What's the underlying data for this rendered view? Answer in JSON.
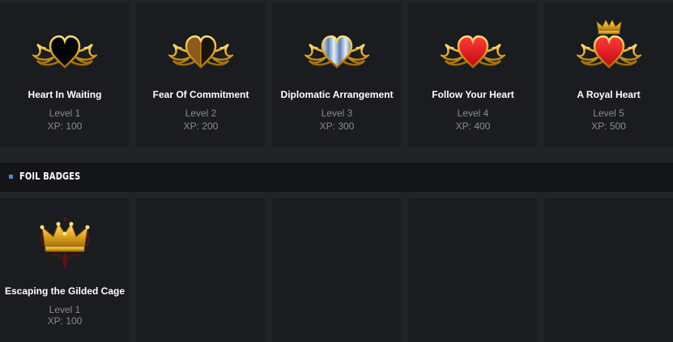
{
  "badges": [
    {
      "name": "Heart In Waiting",
      "level": "Level 1",
      "xp": "XP: 100",
      "icon": "black-heart-icon"
    },
    {
      "name": "Fear Of Commitment",
      "level": "Level 2",
      "xp": "XP: 200",
      "icon": "split-heart-icon"
    },
    {
      "name": "Diplomatic Arrangement",
      "level": "Level 3",
      "xp": "XP: 300",
      "icon": "striped-heart-icon"
    },
    {
      "name": "Follow Your Heart",
      "level": "Level 4",
      "xp": "XP: 400",
      "icon": "red-heart-icon"
    },
    {
      "name": "A Royal Heart",
      "level": "Level 5",
      "xp": "XP: 500",
      "icon": "crowned-heart-icon"
    }
  ],
  "foil_section": {
    "title": "FOIL BADGES",
    "badges": [
      {
        "name": "Escaping the Gilded Cage",
        "level": "Level 1",
        "xp": "XP: 100",
        "icon": "gilded-crown-icon"
      }
    ]
  },
  "colors": {
    "gold": "#e0a51f",
    "red_heart": "#e3161b",
    "accent": "#4a88d6"
  }
}
